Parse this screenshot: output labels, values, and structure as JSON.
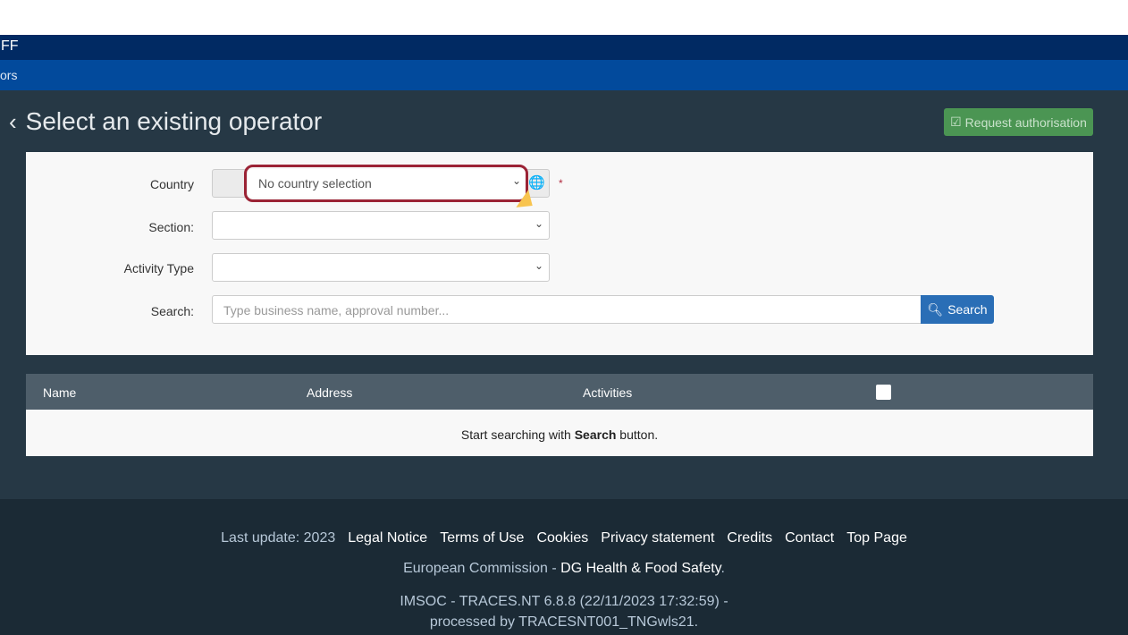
{
  "header": {
    "app_fragment": "FF",
    "nav_fragment": "ors"
  },
  "page": {
    "title": "Select an existing operator",
    "request_button": "Request authorisation"
  },
  "form": {
    "country_label": "Country",
    "country_value": "No country selection",
    "section_label": "Section:",
    "section_value": "",
    "activity_label": "Activity Type",
    "activity_value": "",
    "search_label": "Search:",
    "search_placeholder": "Type business name, approval number...",
    "search_button": "Search"
  },
  "table": {
    "columns": [
      "Name",
      "Address",
      "Activities"
    ],
    "empty_prefix": "Start searching with ",
    "empty_bold": "Search",
    "empty_suffix": " button."
  },
  "footer": {
    "last_update": "Last update: 2023",
    "links": [
      "Legal Notice",
      "Terms of Use",
      "Cookies",
      "Privacy statement",
      "Credits",
      "Contact",
      "Top Page"
    ],
    "ec": "European Commission - ",
    "dg": "DG Health & Food Safety",
    "version": "IMSOC - TRACES.NT 6.8.8 (22/11/2023 17:32:59) -",
    "processed": "processed by TRACESNT001_TNGwls21."
  },
  "colors": {
    "highlight": "#9b2335",
    "primary": "#2a6eb6",
    "success": "#4b9553"
  }
}
